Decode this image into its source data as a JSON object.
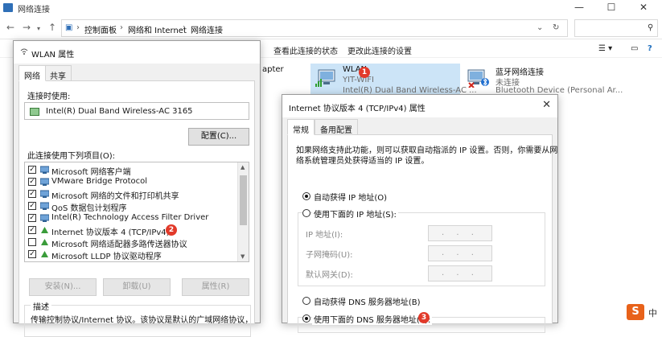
{
  "explorer": {
    "title": "网络连接",
    "breadcrumb": [
      "控制面板",
      "网络和 Internet",
      "网络连接"
    ],
    "commands": [
      "查看此连接的状态",
      "更改此连接的设置"
    ],
    "partial_adapter": "apter",
    "adapters": [
      {
        "name": "WLAN",
        "status": "YIT-WIFI",
        "device": "Intel(R) Dual Band Wireless-AC ...",
        "selected": true
      },
      {
        "name": "蓝牙网络连接",
        "status": "未连接",
        "device": "Bluetooth Device (Personal Ar..."
      }
    ]
  },
  "wlan_dialog": {
    "title": "WLAN 属性",
    "tabs": [
      "网络",
      "共享"
    ],
    "connect_using_label": "连接时使用:",
    "adapter_name": "Intel(R) Dual Band Wireless-AC 3165",
    "configure_button": "配置(C)...",
    "items_label": "此连接使用下列项目(O):",
    "items": [
      {
        "label": "Microsoft 网络客户端",
        "checked": true
      },
      {
        "label": "VMware Bridge Protocol",
        "checked": true
      },
      {
        "label": "Microsoft 网络的文件和打印机共享",
        "checked": true
      },
      {
        "label": "QoS 数据包计划程序",
        "checked": true
      },
      {
        "label": "Intel(R) Technology Access Filter Driver",
        "checked": true
      },
      {
        "label": "Internet 协议版本 4 (TCP/IPv4)",
        "checked": true
      },
      {
        "label": "Microsoft 网络适配器多路传送器协议",
        "checked": false
      },
      {
        "label": "Microsoft LLDP 协议驱动程序",
        "checked": true
      }
    ],
    "install_button": "安装(N)...",
    "uninstall_button": "卸载(U)",
    "properties_button": "属性(R)",
    "description_label": "描述",
    "description_text": "传输控制协议/Internet 协议。该协议是默认的广域网络协议，"
  },
  "ipv4_dialog": {
    "title": "Internet 协议版本 4 (TCP/IPv4) 属性",
    "tabs": [
      "常规",
      "备用配置"
    ],
    "intro_line1": "如果网络支持此功能，则可以获取自动指派的 IP 设置。否则，你需要从网",
    "intro_line2": "络系统管理员处获得适当的 IP 设置。",
    "auto_ip": "自动获得 IP 地址(O)",
    "manual_ip": "使用下面的 IP 地址(S):",
    "ip_label": "IP 地址(I):",
    "mask_label": "子网掩码(U):",
    "gateway_label": "默认网关(D):",
    "ip_placeholder": ". . .",
    "auto_dns": "自动获得 DNS 服务器地址(B)",
    "manual_dns": "使用下面的 DNS 服务器地址(E):"
  },
  "badges": [
    "1",
    "2",
    "3"
  ],
  "tray": {
    "logo": "S",
    "text": "中"
  },
  "colors": {
    "selection": "#cce4f7",
    "badge": "#e23a2a",
    "nic_green": "#3a7c3a"
  }
}
